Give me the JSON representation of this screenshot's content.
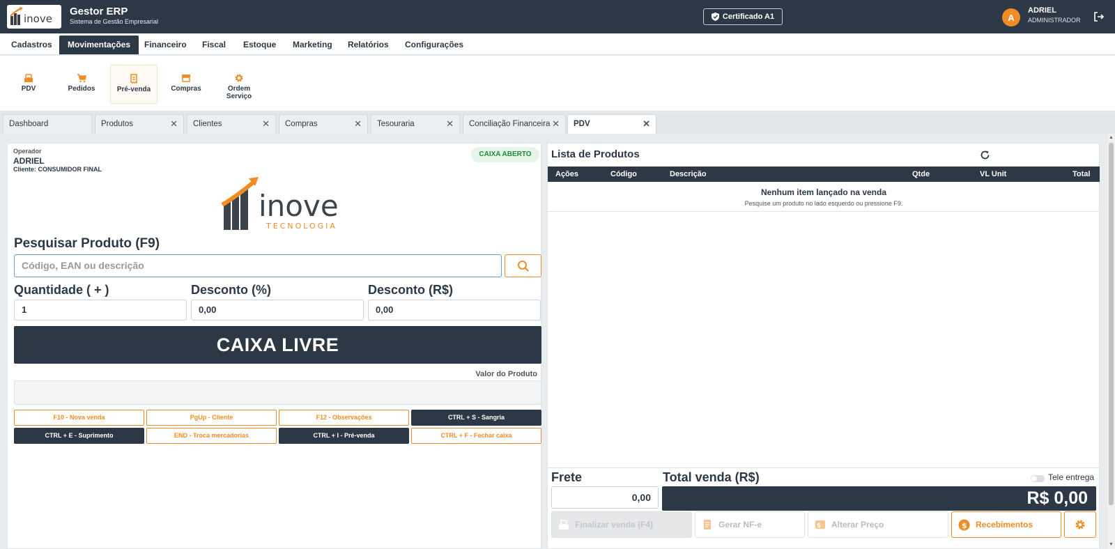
{
  "app": {
    "title": "Gestor ERP",
    "subtitle": "Sistema de Gestão Empresarial",
    "logo_text": "inove",
    "logo_sub": "TECNOLOGIA",
    "certificate": "Certificado A1",
    "avatar_letter": "A",
    "user_name": "ADRIEL",
    "user_role": "ADMINISTRADOR"
  },
  "menu": {
    "items": [
      "Cadastros",
      "Movimentações",
      "Financeiro",
      "Fiscal",
      "Estoque",
      "Marketing",
      "Relatórios",
      "Configurações"
    ],
    "active": "Movimentações"
  },
  "ribbon": {
    "items": [
      "PDV",
      "Pedidos",
      "Pré-venda",
      "Compras",
      "Ordem Serviço"
    ],
    "active": "Pré-venda"
  },
  "tabs": {
    "items": [
      "Dashboard",
      "Produtos",
      "Clientes",
      "Compras",
      "Tesouraria",
      "Conciliação Financeira",
      "PDV"
    ],
    "active": "PDV",
    "close_glyph": "✕"
  },
  "pdv": {
    "operator_label": "Operador",
    "operator_name": "ADRIEL",
    "client": "Cliente: CONSUMIDOR FINAL",
    "status_badge": "CAIXA ABERTO",
    "search_title": "Pesquisar Produto (F9)",
    "search_placeholder": "Código, EAN ou descrição",
    "qty_label": "Quantidade ( + )",
    "qty_value": "1",
    "disc_pct_label": "Desconto (%)",
    "disc_pct_value": "0,00",
    "disc_val_label": "Desconto (R$)",
    "disc_val_value": "0,00",
    "caixa_status": "CAIXA LIVRE",
    "valor_produto_label": "Valor do Produto",
    "shortcuts": [
      {
        "label": "F10 - Nova venda",
        "style": "outline"
      },
      {
        "label": "PgUp - Cliente",
        "style": "outline"
      },
      {
        "label": "F12 - Observações",
        "style": "outline"
      },
      {
        "label": "CTRL + S - Sangria",
        "style": "dark"
      },
      {
        "label": "CTRL + E - Suprimento",
        "style": "dark"
      },
      {
        "label": "END - Troca mercadorias",
        "style": "outline"
      },
      {
        "label": "CTRL + I - Pré-venda",
        "style": "dark"
      },
      {
        "label": "CTRL + F - Fechar caixa",
        "style": "outline"
      }
    ]
  },
  "products": {
    "title": "Lista de Produtos",
    "columns": [
      "Ações",
      "Código",
      "Descrição",
      "Qtde",
      "VL Unit",
      "Total"
    ],
    "empty_title": "Nenhum item lançado na venda",
    "empty_sub": "Pesquise um produto no lado esquerdo ou pressione F9."
  },
  "totals": {
    "frete_label": "Frete",
    "frete_value": "0,00",
    "total_label": "Total venda (R$)",
    "tele_label": "Tele entrega",
    "total_value": "R$ 0,00"
  },
  "actions": {
    "finalizar": "Finalizar venda (F4)",
    "nfe": "Gerar NF-e",
    "alterar": "Alterar Preço",
    "recebimentos": "Recebimentos"
  },
  "colors": {
    "primary": "#2d3846",
    "accent": "#f08c25",
    "success": "#1f8a3c"
  }
}
